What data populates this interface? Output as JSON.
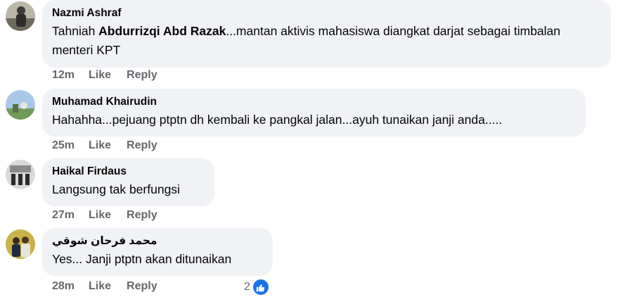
{
  "comments": [
    {
      "author": "Nazmi Ashraf",
      "text_prefix": "Tahniah ",
      "text_mention": "Abdurrizqi Abd Razak",
      "text_suffix": "...mantan aktivis mahasiswa diangkat darjat sebagai timbalan menteri KPT",
      "time": "12m",
      "like_label": "Like",
      "reply_label": "Reply"
    },
    {
      "author": "Muhamad Khairudin",
      "text": "Hahahha...pejuang ptptn dh kembali ke pangkal jalan...ayuh tunaikan janji anda.....",
      "time": "25m",
      "like_label": "Like",
      "reply_label": "Reply"
    },
    {
      "author": "Haikal Firdaus",
      "text": "Langsung tak berfungsi",
      "time": "27m",
      "like_label": "Like",
      "reply_label": "Reply"
    },
    {
      "author": "محمد فرحان شوقي",
      "text": "Yes... Janji ptptn akan ditunaikan",
      "time": "28m",
      "like_label": "Like",
      "reply_label": "Reply",
      "reaction_count": "2",
      "reaction_icon": "thumbs-up-icon"
    }
  ],
  "colors": {
    "bubble": "#f0f2f5",
    "secondary_text": "#65676b",
    "like_blue": "#1b74e4"
  }
}
